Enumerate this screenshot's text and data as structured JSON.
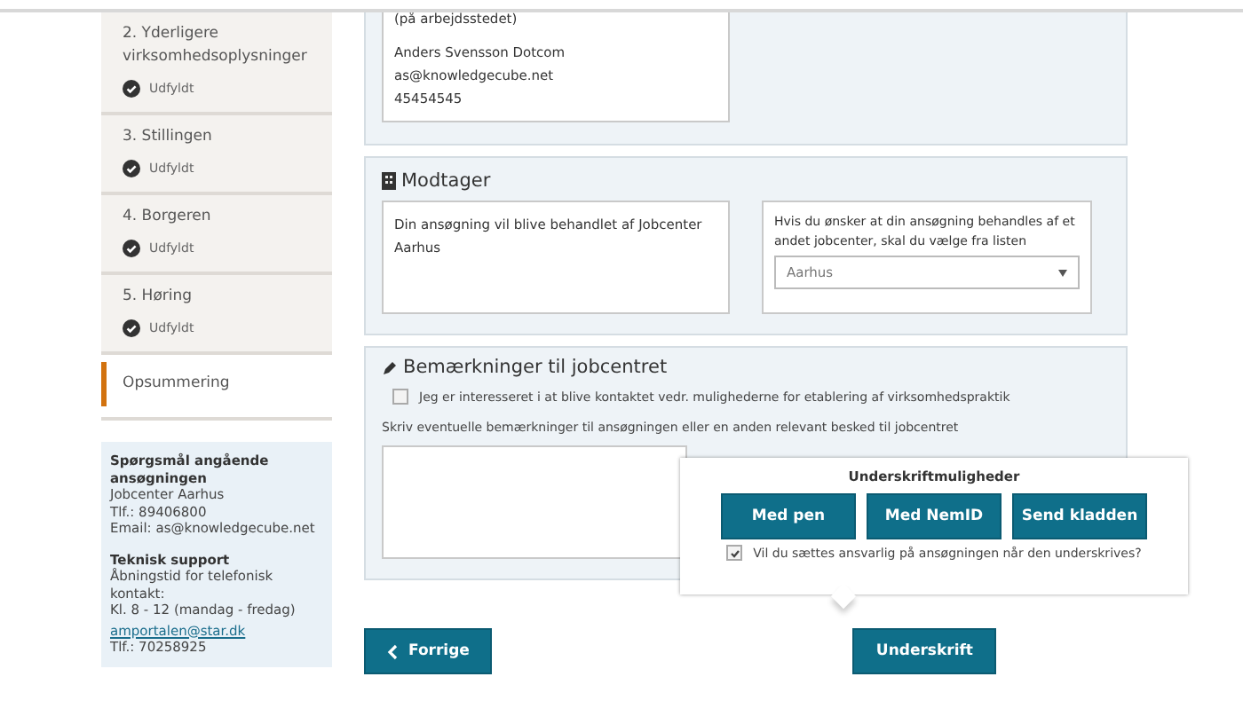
{
  "sidebar": {
    "steps": [
      {
        "title": "2. Yderligere virksomhedsoplysninger",
        "status": "Udfyldt",
        "selected": false
      },
      {
        "title": "3. Stillingen",
        "status": "Udfyldt",
        "selected": false
      },
      {
        "title": "4. Borgeren",
        "status": "Udfyldt",
        "selected": false
      },
      {
        "title": "5. Høring",
        "status": "Udfyldt",
        "selected": false
      },
      {
        "title": "Opsummering",
        "selected": true
      }
    ],
    "info": [
      {
        "heading": "Spørgsmål angående ansøgningen",
        "lines": [
          {
            "text": "Jobcenter Aarhus"
          },
          {
            "text": "Tlf.: 89406800"
          },
          {
            "text": "Email: as@knowledgecube.net"
          }
        ]
      },
      {
        "heading": "Teknisk support",
        "lines": [
          {
            "text": "Åbningstid for telefonisk kontakt:"
          },
          {
            "text": "Kl. 8 - 12 (mandag - fredag)"
          },
          {
            "text": "amportalen@star.dk",
            "kind": "link"
          },
          {
            "text": "Tlf.: 70258925"
          }
        ]
      }
    ]
  },
  "contact": {
    "lines": [
      "(på arbejdsstedet)",
      "Anders Svensson Dotcom",
      "as@knowledgecube.net",
      "45454545"
    ]
  },
  "recipient": {
    "title": "Modtager",
    "note": "Din ansøgning vil blive behandlet af Jobcenter Aarhus",
    "choose_label": "Hvis du ønsker at din ansøgning behandles af et andet jobcenter, skal du vælge fra listen",
    "select_value": "Aarhus"
  },
  "remarks": {
    "title": "Bemærkninger til jobcentret",
    "checkbox": {
      "label": "Jeg er interesseret i at blive kontaktet vedr. mulighederne for etablering af virksomhedspraktik",
      "checked": false
    },
    "textarea_label": "Skriv eventuelle bemærkninger til ansøgningen eller en anden relevant besked til jobcentret"
  },
  "popover": {
    "title": "Underskriftmuligheder",
    "buttons": [
      "Med pen",
      "Med NemID",
      "Send kladden"
    ],
    "checkbox": {
      "label": "Vil du sættes ansvarlig på ansøgningen når den underskrives?",
      "checked": true
    }
  },
  "footer": {
    "back": "Forrige",
    "sign": "Underskrift"
  }
}
